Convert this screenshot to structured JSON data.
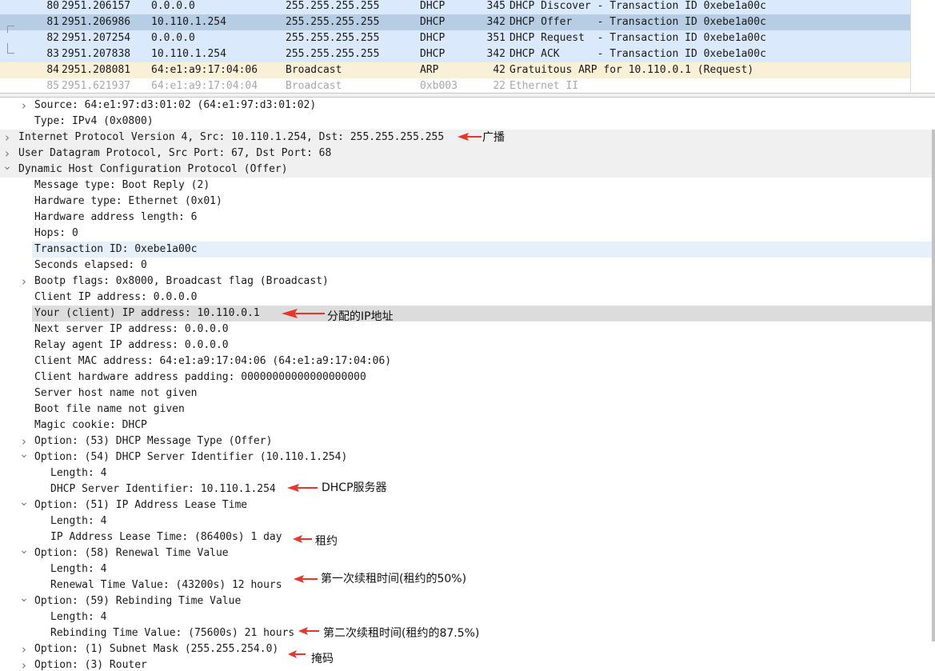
{
  "packet_list": {
    "rows": [
      {
        "no": "80",
        "time": "2951.206157",
        "src": "0.0.0.0",
        "dst": "255.255.255.255",
        "proto": "DHCP",
        "len": "345",
        "info": "DHCP Discover - Transaction ID 0xebe1a00c",
        "bg": "#dae9fb"
      },
      {
        "no": "81",
        "time": "2951.206986",
        "src": "10.110.1.254",
        "dst": "255.255.255.255",
        "proto": "DHCP",
        "len": "342",
        "info": "DHCP Offer    - Transaction ID 0xebe1a00c",
        "bg": "#b7cde3"
      },
      {
        "no": "82",
        "time": "2951.207254",
        "src": "0.0.0.0",
        "dst": "255.255.255.255",
        "proto": "DHCP",
        "len": "351",
        "info": "DHCP Request  - Transaction ID 0xebe1a00c",
        "bg": "#dae9fb"
      },
      {
        "no": "83",
        "time": "2951.207838",
        "src": "10.110.1.254",
        "dst": "255.255.255.255",
        "proto": "DHCP",
        "len": "342",
        "info": "DHCP ACK      - Transaction ID 0xebe1a00c",
        "bg": "#dae9fb"
      },
      {
        "no": "84",
        "time": "2951.208081",
        "src": "64:e1:a9:17:04:06",
        "dst": "Broadcast",
        "proto": "ARP",
        "len": "42",
        "info": "Gratuitous ARP for 10.110.0.1 (Request)",
        "bg": "#faf0d7"
      },
      {
        "no": "85",
        "time": "2951.621937",
        "src": "64:e1:a9:17:04:04",
        "dst": "Broadcast",
        "proto": "0xb003",
        "len": "22",
        "info": "Ethernet II",
        "bg": "#ffffff"
      }
    ]
  },
  "detail_tree": {
    "rows": [
      {
        "text": "Source: 64:e1:97:d3:01:02 (64:e1:97:d3:01:02)",
        "depth": 1,
        "toggle": "collapsed",
        "bg": ""
      },
      {
        "text": "Type: IPv4 (0x0800)",
        "depth": 1,
        "toggle": "",
        "bg": ""
      },
      {
        "text": "Internet Protocol Version 4, Src: 10.110.1.254, Dst: 255.255.255.255",
        "depth": 0,
        "toggle": "collapsed",
        "bg": "#f0f0f0"
      },
      {
        "text": "User Datagram Protocol, Src Port: 67, Dst Port: 68",
        "depth": 0,
        "toggle": "collapsed",
        "bg": "#f0f0f0"
      },
      {
        "text": "Dynamic Host Configuration Protocol (Offer)",
        "depth": 0,
        "toggle": "expanded",
        "bg": "#f0f0f0"
      },
      {
        "text": "Message type: Boot Reply (2)",
        "depth": 1,
        "toggle": "",
        "bg": ""
      },
      {
        "text": "Hardware type: Ethernet (0x01)",
        "depth": 1,
        "toggle": "",
        "bg": ""
      },
      {
        "text": "Hardware address length: 6",
        "depth": 1,
        "toggle": "",
        "bg": ""
      },
      {
        "text": "Hops: 0",
        "depth": 1,
        "toggle": "",
        "bg": ""
      },
      {
        "text": "Transaction ID: 0xebe1a00c",
        "depth": 1,
        "toggle": "",
        "bg": "#e6f0fa"
      },
      {
        "text": "Seconds elapsed: 0",
        "depth": 1,
        "toggle": "",
        "bg": ""
      },
      {
        "text": "Bootp flags: 0x8000, Broadcast flag (Broadcast)",
        "depth": 1,
        "toggle": "collapsed",
        "bg": ""
      },
      {
        "text": "Client IP address: 0.0.0.0",
        "depth": 1,
        "toggle": "",
        "bg": ""
      },
      {
        "text": "Your (client) IP address: 10.110.0.1",
        "depth": 1,
        "toggle": "",
        "bg": "#dcdcdc"
      },
      {
        "text": "Next server IP address: 0.0.0.0",
        "depth": 1,
        "toggle": "",
        "bg": ""
      },
      {
        "text": "Relay agent IP address: 0.0.0.0",
        "depth": 1,
        "toggle": "",
        "bg": ""
      },
      {
        "text": "Client MAC address: 64:e1:a9:17:04:06 (64:e1:a9:17:04:06)",
        "depth": 1,
        "toggle": "",
        "bg": ""
      },
      {
        "text": "Client hardware address padding: 00000000000000000000",
        "depth": 1,
        "toggle": "",
        "bg": ""
      },
      {
        "text": "Server host name not given",
        "depth": 1,
        "toggle": "",
        "bg": ""
      },
      {
        "text": "Boot file name not given",
        "depth": 1,
        "toggle": "",
        "bg": ""
      },
      {
        "text": "Magic cookie: DHCP",
        "depth": 1,
        "toggle": "",
        "bg": ""
      },
      {
        "text": "Option: (53) DHCP Message Type (Offer)",
        "depth": 1,
        "toggle": "collapsed",
        "bg": ""
      },
      {
        "text": "Option: (54) DHCP Server Identifier (10.110.1.254)",
        "depth": 1,
        "toggle": "expanded",
        "bg": ""
      },
      {
        "text": "Length: 4",
        "depth": 2,
        "toggle": "",
        "bg": ""
      },
      {
        "text": "DHCP Server Identifier: 10.110.1.254",
        "depth": 2,
        "toggle": "",
        "bg": ""
      },
      {
        "text": "Option: (51) IP Address Lease Time",
        "depth": 1,
        "toggle": "expanded",
        "bg": ""
      },
      {
        "text": "Length: 4",
        "depth": 2,
        "toggle": "",
        "bg": ""
      },
      {
        "text": "IP Address Lease Time: (86400s) 1 day",
        "depth": 2,
        "toggle": "",
        "bg": ""
      },
      {
        "text": "Option: (58) Renewal Time Value",
        "depth": 1,
        "toggle": "expanded",
        "bg": ""
      },
      {
        "text": "Length: 4",
        "depth": 2,
        "toggle": "",
        "bg": ""
      },
      {
        "text": "Renewal Time Value: (43200s) 12 hours",
        "depth": 2,
        "toggle": "",
        "bg": ""
      },
      {
        "text": "Option: (59) Rebinding Time Value",
        "depth": 1,
        "toggle": "expanded",
        "bg": ""
      },
      {
        "text": "Length: 4",
        "depth": 2,
        "toggle": "",
        "bg": ""
      },
      {
        "text": "Rebinding Time Value: (75600s) 21 hours",
        "depth": 2,
        "toggle": "",
        "bg": ""
      },
      {
        "text": "Option: (1) Subnet Mask (255.255.254.0)",
        "depth": 1,
        "toggle": "collapsed",
        "bg": ""
      },
      {
        "text": "Option: (3) Router",
        "depth": 1,
        "toggle": "collapsed",
        "bg": ""
      }
    ]
  },
  "annotations": {
    "broadcast": "广播",
    "assigned_ip": "分配的IP地址",
    "dhcp_server": "DHCP服务器",
    "lease": "租约",
    "first_renewal": "第一次续租时间(租约的50%)",
    "second_renewal": "第二次续租时间(租约的87.5%)",
    "mask": "掩码"
  },
  "colors": {
    "annotation_arrow": "#e8362b"
  }
}
